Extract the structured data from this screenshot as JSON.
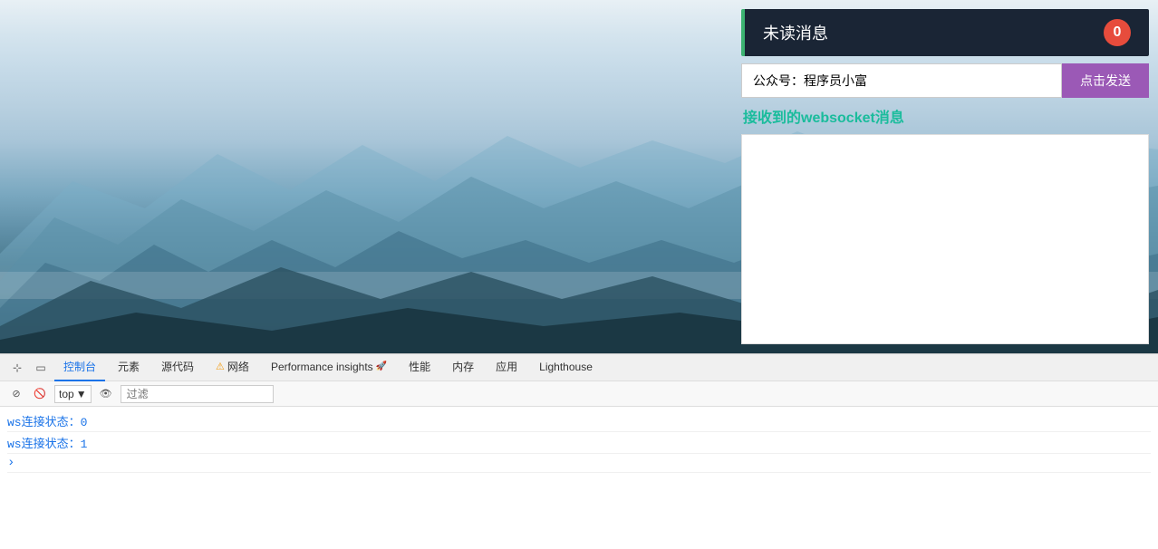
{
  "page": {
    "unread_title": "未读消息",
    "unread_count": "0",
    "input_placeholder": "公众号：程序员小富",
    "send_button_label": "点击发送",
    "received_label": "接收到的websocket消息",
    "message_content": ""
  },
  "devtools": {
    "tabs": [
      {
        "id": "console",
        "label": "控制台",
        "active": true
      },
      {
        "id": "elements",
        "label": "元素",
        "active": false
      },
      {
        "id": "sources",
        "label": "源代码",
        "active": false
      },
      {
        "id": "network",
        "label": "网络",
        "active": false,
        "has_warning": true
      },
      {
        "id": "performance_insights",
        "label": "Performance insights",
        "active": false,
        "has_rocket": true
      },
      {
        "id": "performance",
        "label": "性能",
        "active": false
      },
      {
        "id": "memory",
        "label": "内存",
        "active": false
      },
      {
        "id": "application",
        "label": "应用",
        "active": false
      },
      {
        "id": "lighthouse",
        "label": "Lighthouse",
        "active": false
      }
    ],
    "context_selector": "top",
    "filter_placeholder": "过滤",
    "console_lines": [
      {
        "text": "ws连接状态：0",
        "type": "ws-log"
      },
      {
        "text": "ws连接状态：1",
        "type": "ws-log"
      }
    ]
  },
  "icons": {
    "cursor": "⊹",
    "device": "□",
    "chevron_down": "▼",
    "eye": "👁",
    "warning": "⚠",
    "rocket": "🚀",
    "stop": "⊘",
    "clear": "🚫",
    "arrow_right": ">"
  }
}
